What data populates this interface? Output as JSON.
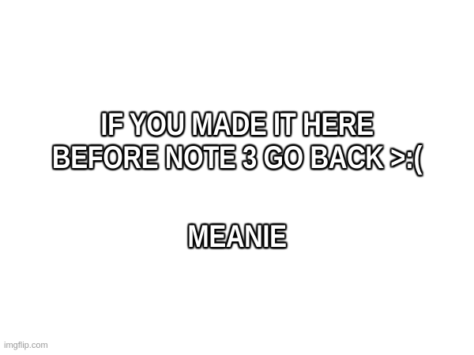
{
  "caption": {
    "line1": "IF YOU MADE IT HERE",
    "line2": "BEFORE NOTE 3 GO BACK >:(",
    "line3": "MEANIE"
  },
  "watermark": "imgflip.com",
  "colors": {
    "background": "#ffffff",
    "text_fill": "#ffffff",
    "text_outline": "#000000",
    "watermark": "#9a9a9a"
  }
}
